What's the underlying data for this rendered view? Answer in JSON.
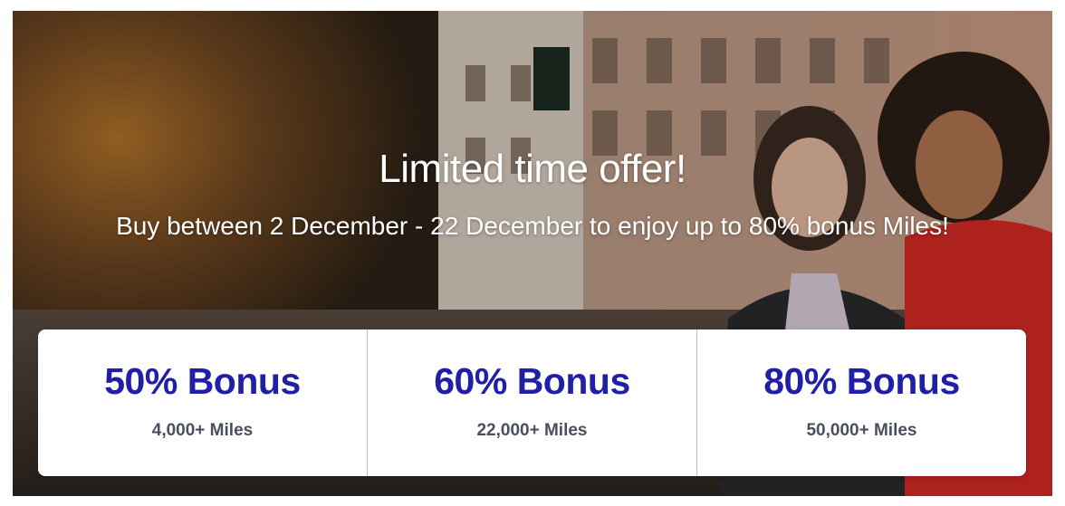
{
  "banner": {
    "headline": "Limited time offer!",
    "subline": "Buy between 2 December - 22 December to enjoy up to 80% bonus Miles!",
    "offers": [
      {
        "bonus": "50% Bonus",
        "miles": "4,000+ Miles"
      },
      {
        "bonus": "60% Bonus",
        "miles": "22,000+ Miles"
      },
      {
        "bonus": "80% Bonus",
        "miles": "50,000+ Miles"
      }
    ],
    "colors": {
      "bonus_text": "#1f1fa8",
      "miles_text": "#4a4f5e",
      "card_divider": "#b9bcd6"
    }
  }
}
